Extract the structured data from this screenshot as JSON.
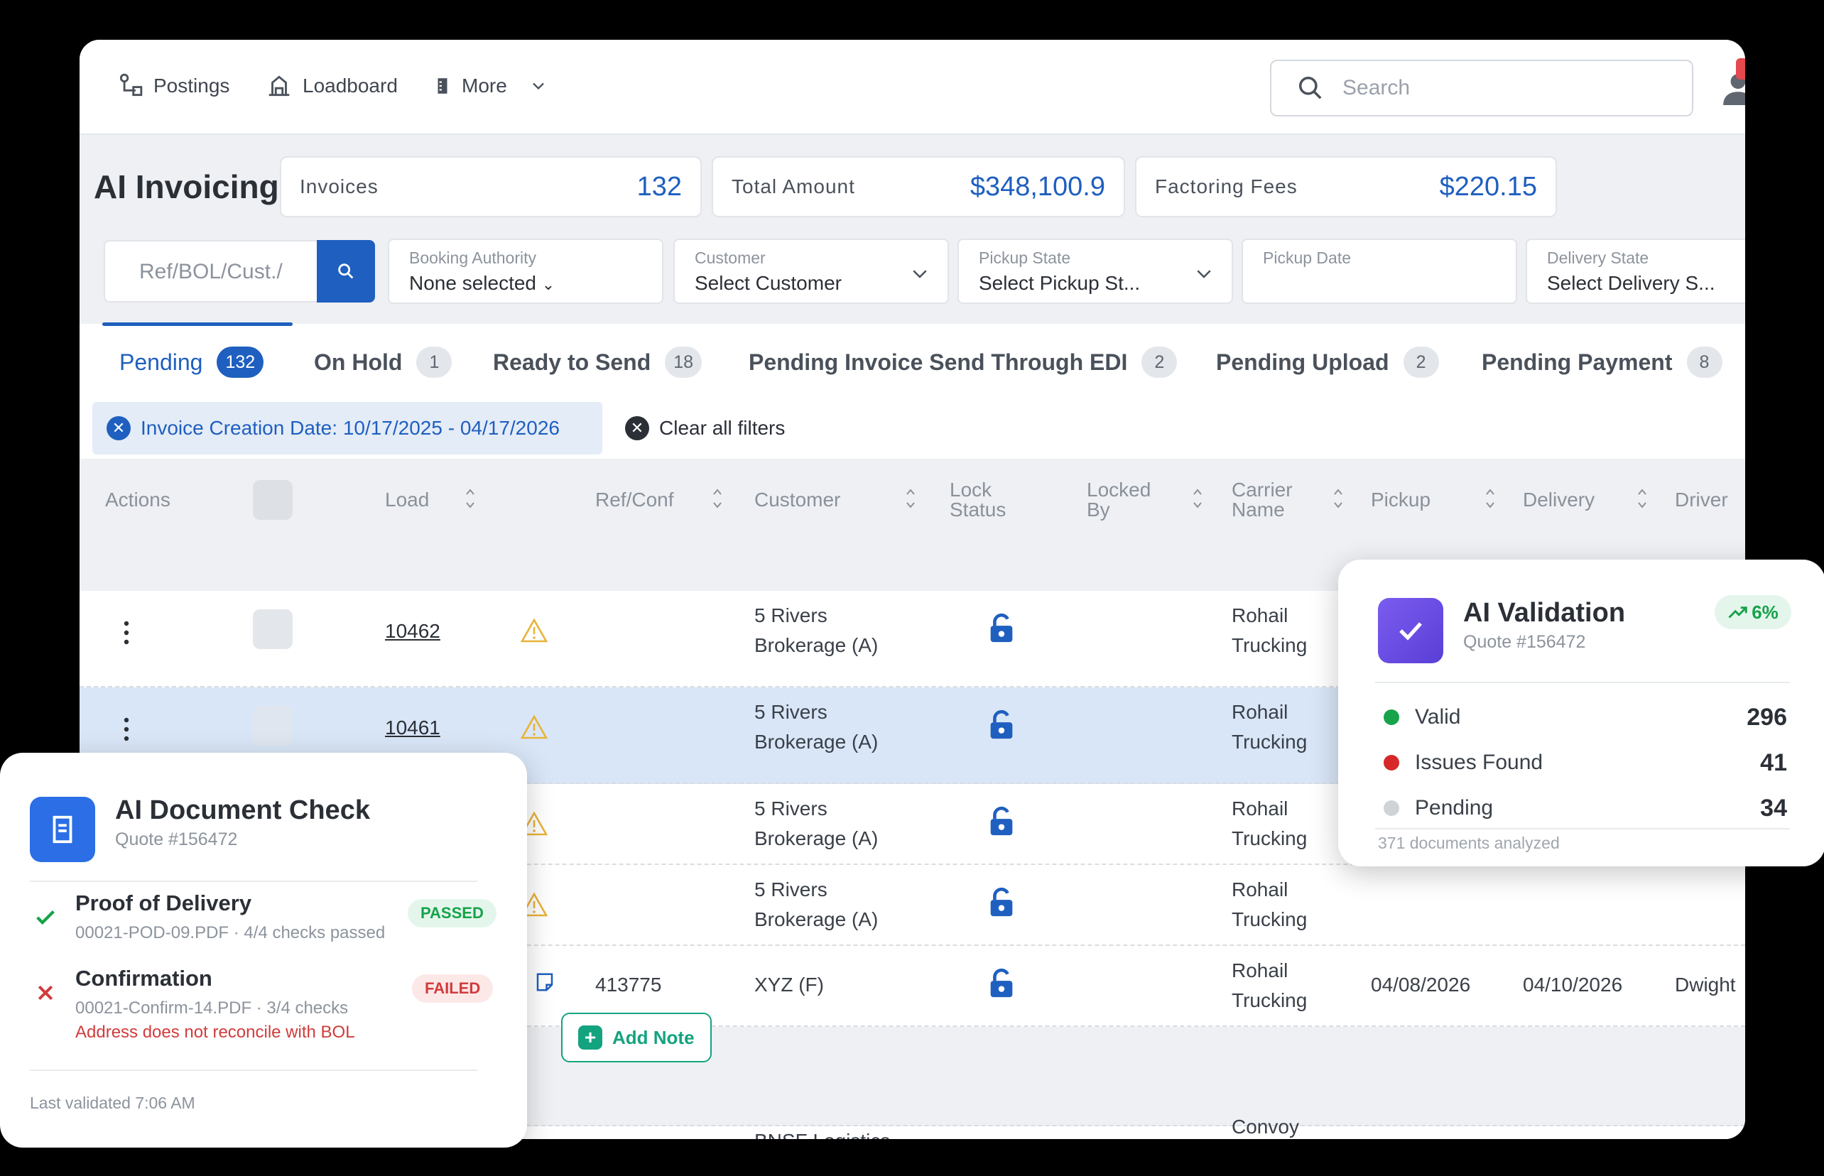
{
  "nav": {
    "postings": "Postings",
    "loadboard": "Loadboard",
    "more": "More"
  },
  "search": {
    "placeholder": "Search"
  },
  "page": {
    "title": "AI Invoicing"
  },
  "stats": {
    "invoices_label": "Invoices",
    "invoices_value": "132",
    "total_label": "Total Amount",
    "total_value": "$348,100.9",
    "fees_label": "Factoring Fees",
    "fees_value": "$220.15"
  },
  "filters": {
    "ref_placeholder": "Ref/BOL/Cust./",
    "booking_label": "Booking Authority",
    "booking_value": "None selected",
    "customer_label": "Customer",
    "customer_value": "Select Customer",
    "pickup_state_label": "Pickup State",
    "pickup_state_value": "Select Pickup St...",
    "pickup_date_label": "Pickup Date",
    "delivery_state_label": "Delivery State",
    "delivery_state_value": "Select Delivery S..."
  },
  "tabs": [
    {
      "label": "Pending",
      "count": "132"
    },
    {
      "label": "On Hold",
      "count": "1"
    },
    {
      "label": "Ready to Send",
      "count": "18"
    },
    {
      "label": "Pending Invoice Send Through EDI",
      "count": "2"
    },
    {
      "label": "Pending Upload",
      "count": "2"
    },
    {
      "label": "Pending Payment",
      "count": "8"
    }
  ],
  "chips": {
    "date_filter": "Invoice Creation Date: 10/17/2025 - 04/17/2026",
    "clear_all": "Clear all filters"
  },
  "table": {
    "headers": {
      "actions": "Actions",
      "load": "Load",
      "ref": "Ref/Conf",
      "customer": "Customer",
      "lock1": "Lock",
      "lock2": "Status",
      "locked1": "Locked",
      "locked2": "By",
      "carrier1": "Carrier",
      "carrier2": "Name",
      "pickup": "Pickup",
      "delivery": "Delivery",
      "driver": "Driver"
    },
    "rows": [
      {
        "load": "10462",
        "customer1": "5 Rivers",
        "customer2": "Brokerage (A)",
        "carrier1": "Rohail",
        "carrier2": "Trucking"
      },
      {
        "load": "10461",
        "customer1": "5 Rivers",
        "customer2": "Brokerage (A)",
        "carrier1": "Rohail",
        "carrier2": "Trucking"
      },
      {
        "customer1": "5 Rivers",
        "customer2": "Brokerage (A)",
        "carrier1": "Rohail",
        "carrier2": "Trucking"
      },
      {
        "customer1": "5 Rivers",
        "customer2": "Brokerage (A)",
        "carrier1": "Rohail",
        "carrier2": "Trucking"
      },
      {
        "ref": "413775",
        "customer1": "XYZ (F)",
        "carrier1": "Rohail",
        "carrier2": "Trucking",
        "pickup": "04/08/2026",
        "delivery": "04/10/2026",
        "driver": "Dwight"
      }
    ],
    "last_row": {
      "customer1": "BNSF Logistics",
      "carrier1": "Convoy"
    },
    "add_note": "Add Note"
  },
  "ai_validation": {
    "title": "AI Validation",
    "quote": "Quote #156472",
    "trend": "6%",
    "items": [
      {
        "label": "Valid",
        "value": "296",
        "color": "#16a34a"
      },
      {
        "label": "Issues Found",
        "value": "41",
        "color": "#d62828"
      },
      {
        "label": "Pending",
        "value": "34",
        "color": "#cfd3d8"
      }
    ],
    "footer": "371 documents analyzed"
  },
  "ai_document_check": {
    "title": "AI Document Check",
    "quote": "Quote #156472",
    "pod_name": "Proof of Delivery",
    "pod_meta": "00021-POD-09.PDF · 4/4 checks passed",
    "pod_status": "PASSED",
    "conf_name": "Confirmation",
    "conf_meta": "00021-Confirm-14.PDF · 3/4 checks",
    "conf_error": "Address does not reconcile with BOL",
    "conf_status": "FAILED",
    "footer": "Last validated 7:06 AM"
  },
  "colors": {
    "primary": "#1f5fbf",
    "success": "#16a34a",
    "danger": "#d23b3b",
    "warning": "#e8b339"
  }
}
